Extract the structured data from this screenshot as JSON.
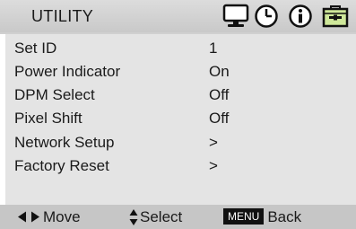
{
  "header": {
    "title": "UTILITY",
    "icons": [
      "monitor-icon",
      "clock-icon",
      "info-icon",
      "toolbox-icon"
    ]
  },
  "menu": {
    "items": [
      {
        "label": "Set ID",
        "value": "1"
      },
      {
        "label": "Power Indicator",
        "value": "On"
      },
      {
        "label": "DPM Select",
        "value": "Off"
      },
      {
        "label": "Pixel Shift",
        "value": "Off"
      },
      {
        "label": "Network Setup",
        "value": ">"
      },
      {
        "label": "Factory Reset",
        "value": ">"
      }
    ]
  },
  "footer": {
    "move_label": "Move",
    "select_label": "Select",
    "menu_key": "MENU",
    "back_label": "Back"
  },
  "colors": {
    "header_bg": "#d4d4d4",
    "body_bg": "#e4e4e4",
    "footer_bg": "#c6c6c6",
    "active_icon_bg": "#cfe89a"
  }
}
